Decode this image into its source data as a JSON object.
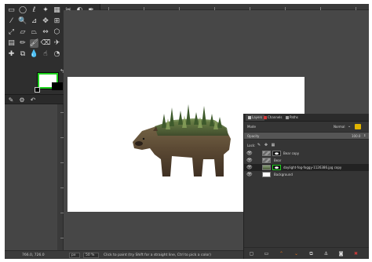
{
  "toolbox": {
    "tools": [
      {
        "name": "rect-select-icon",
        "glyph": "▭"
      },
      {
        "name": "ellipse-select-icon",
        "glyph": "◯"
      },
      {
        "name": "free-select-icon",
        "glyph": "ℓ"
      },
      {
        "name": "fuzzy-select-icon",
        "glyph": "✦"
      },
      {
        "name": "color-select-icon",
        "glyph": "▦"
      },
      {
        "name": "scissors-select-icon",
        "glyph": "✂"
      },
      {
        "name": "foreground-select-icon",
        "glyph": "◐"
      },
      {
        "name": "paths-icon",
        "glyph": "✒"
      },
      {
        "name": "color-picker-icon",
        "glyph": "⁄"
      },
      {
        "name": "zoom-icon",
        "glyph": "🔍"
      },
      {
        "name": "measure-icon",
        "glyph": "⊿"
      },
      {
        "name": "move-icon",
        "glyph": "✥"
      },
      {
        "name": "align-icon",
        "glyph": "⊞"
      },
      {
        "name": "crop-icon",
        "glyph": "⌗"
      },
      {
        "name": "unified-transform-icon",
        "glyph": "◈"
      },
      {
        "name": "rotate-icon",
        "glyph": "↻"
      },
      {
        "name": "scale-icon",
        "glyph": "⤢"
      },
      {
        "name": "shear-icon",
        "glyph": "▱"
      },
      {
        "name": "perspective-icon",
        "glyph": "⏢"
      },
      {
        "name": "flip-icon",
        "glyph": "⇔"
      },
      {
        "name": "cage-icon",
        "glyph": "⬡"
      },
      {
        "name": "warp-icon",
        "glyph": "≈"
      },
      {
        "name": "text-icon",
        "glyph": "A"
      },
      {
        "name": "bucket-fill-icon",
        "glyph": "⬙"
      },
      {
        "name": "gradient-icon",
        "glyph": "▤"
      },
      {
        "name": "pencil-icon",
        "glyph": "✏"
      },
      {
        "name": "paintbrush-icon",
        "glyph": "🖌"
      },
      {
        "name": "eraser-icon",
        "glyph": "⌫"
      },
      {
        "name": "airbrush-icon",
        "glyph": "✈"
      },
      {
        "name": "ink-icon",
        "glyph": "✒"
      },
      {
        "name": "mypaint-brush-icon",
        "glyph": "✎"
      },
      {
        "name": "clone-icon",
        "glyph": "⎘"
      },
      {
        "name": "heal-icon",
        "glyph": "✚"
      },
      {
        "name": "perspective-clone-icon",
        "glyph": "⧉"
      },
      {
        "name": "blur-icon",
        "glyph": "💧"
      },
      {
        "name": "smudge-icon",
        "glyph": "☝"
      },
      {
        "name": "dodge-burn-icon",
        "glyph": "◔"
      }
    ],
    "fg_color": "#ffffff",
    "bg_color": "#000000",
    "swap_glyph": "↰",
    "bottom_icons": [
      {
        "name": "tool-options-icon",
        "glyph": "✎"
      },
      {
        "name": "device-status-icon",
        "glyph": "⚙"
      },
      {
        "name": "undo-history-icon",
        "glyph": "↶"
      },
      {
        "name": "images-icon",
        "glyph": "▣"
      }
    ]
  },
  "status": {
    "coords": "766.0, 726.0",
    "unit": "px",
    "zoom": "50 %",
    "message": "Click to paint (try Shift for a straight line, Ctrl to pick a color)"
  },
  "layers_panel": {
    "tabs": [
      {
        "label": "Layers",
        "icon_color": "#c8c8c8"
      },
      {
        "label": "Channels",
        "icon_color": "#d23a3a"
      },
      {
        "label": "Paths",
        "icon_color": "#a0a0a0"
      }
    ],
    "mode_label": "Mode",
    "mode_value": "Normal",
    "opacity_label": "Opacity",
    "opacity_value": "100.0",
    "lock_label": "Lock:",
    "lock_icons": [
      {
        "name": "lock-pixels-icon",
        "glyph": "✎"
      },
      {
        "name": "lock-position-icon",
        "glyph": "✥"
      },
      {
        "name": "lock-alpha-icon",
        "glyph": "▦"
      }
    ],
    "layers": [
      {
        "name": "Bear copy",
        "has_mask": true,
        "selected": false,
        "active_mask": false
      },
      {
        "name": "Bear",
        "has_mask": false,
        "selected": false,
        "active_mask": false
      },
      {
        "name": "daylight-fog-foggy-1126386.jpg copy",
        "has_mask": true,
        "selected": true,
        "active_mask": true
      },
      {
        "name": "Background",
        "has_mask": false,
        "selected": false,
        "active_mask": false
      }
    ],
    "footer_icons": [
      {
        "name": "new-layer-icon",
        "glyph": "▢",
        "color": "#dddddd"
      },
      {
        "name": "new-layer-group-icon",
        "glyph": "▭",
        "color": "#dddddd"
      },
      {
        "name": "raise-layer-icon",
        "glyph": "⌃",
        "color": "#e0701a"
      },
      {
        "name": "lower-layer-icon",
        "glyph": "⌄",
        "color": "#e0701a"
      },
      {
        "name": "duplicate-layer-icon",
        "glyph": "⧉",
        "color": "#dddddd"
      },
      {
        "name": "anchor-layer-icon",
        "glyph": "⚓",
        "color": "#dddddd"
      },
      {
        "name": "add-mask-icon",
        "glyph": "◙",
        "color": "#dddddd"
      },
      {
        "name": "delete-layer-icon",
        "glyph": "✖",
        "color": "#d23a3a"
      }
    ]
  },
  "colors": {
    "accent_green": "#1fd11f",
    "panel_dark": "#2e2e2e",
    "canvas_bg": "#474747"
  }
}
